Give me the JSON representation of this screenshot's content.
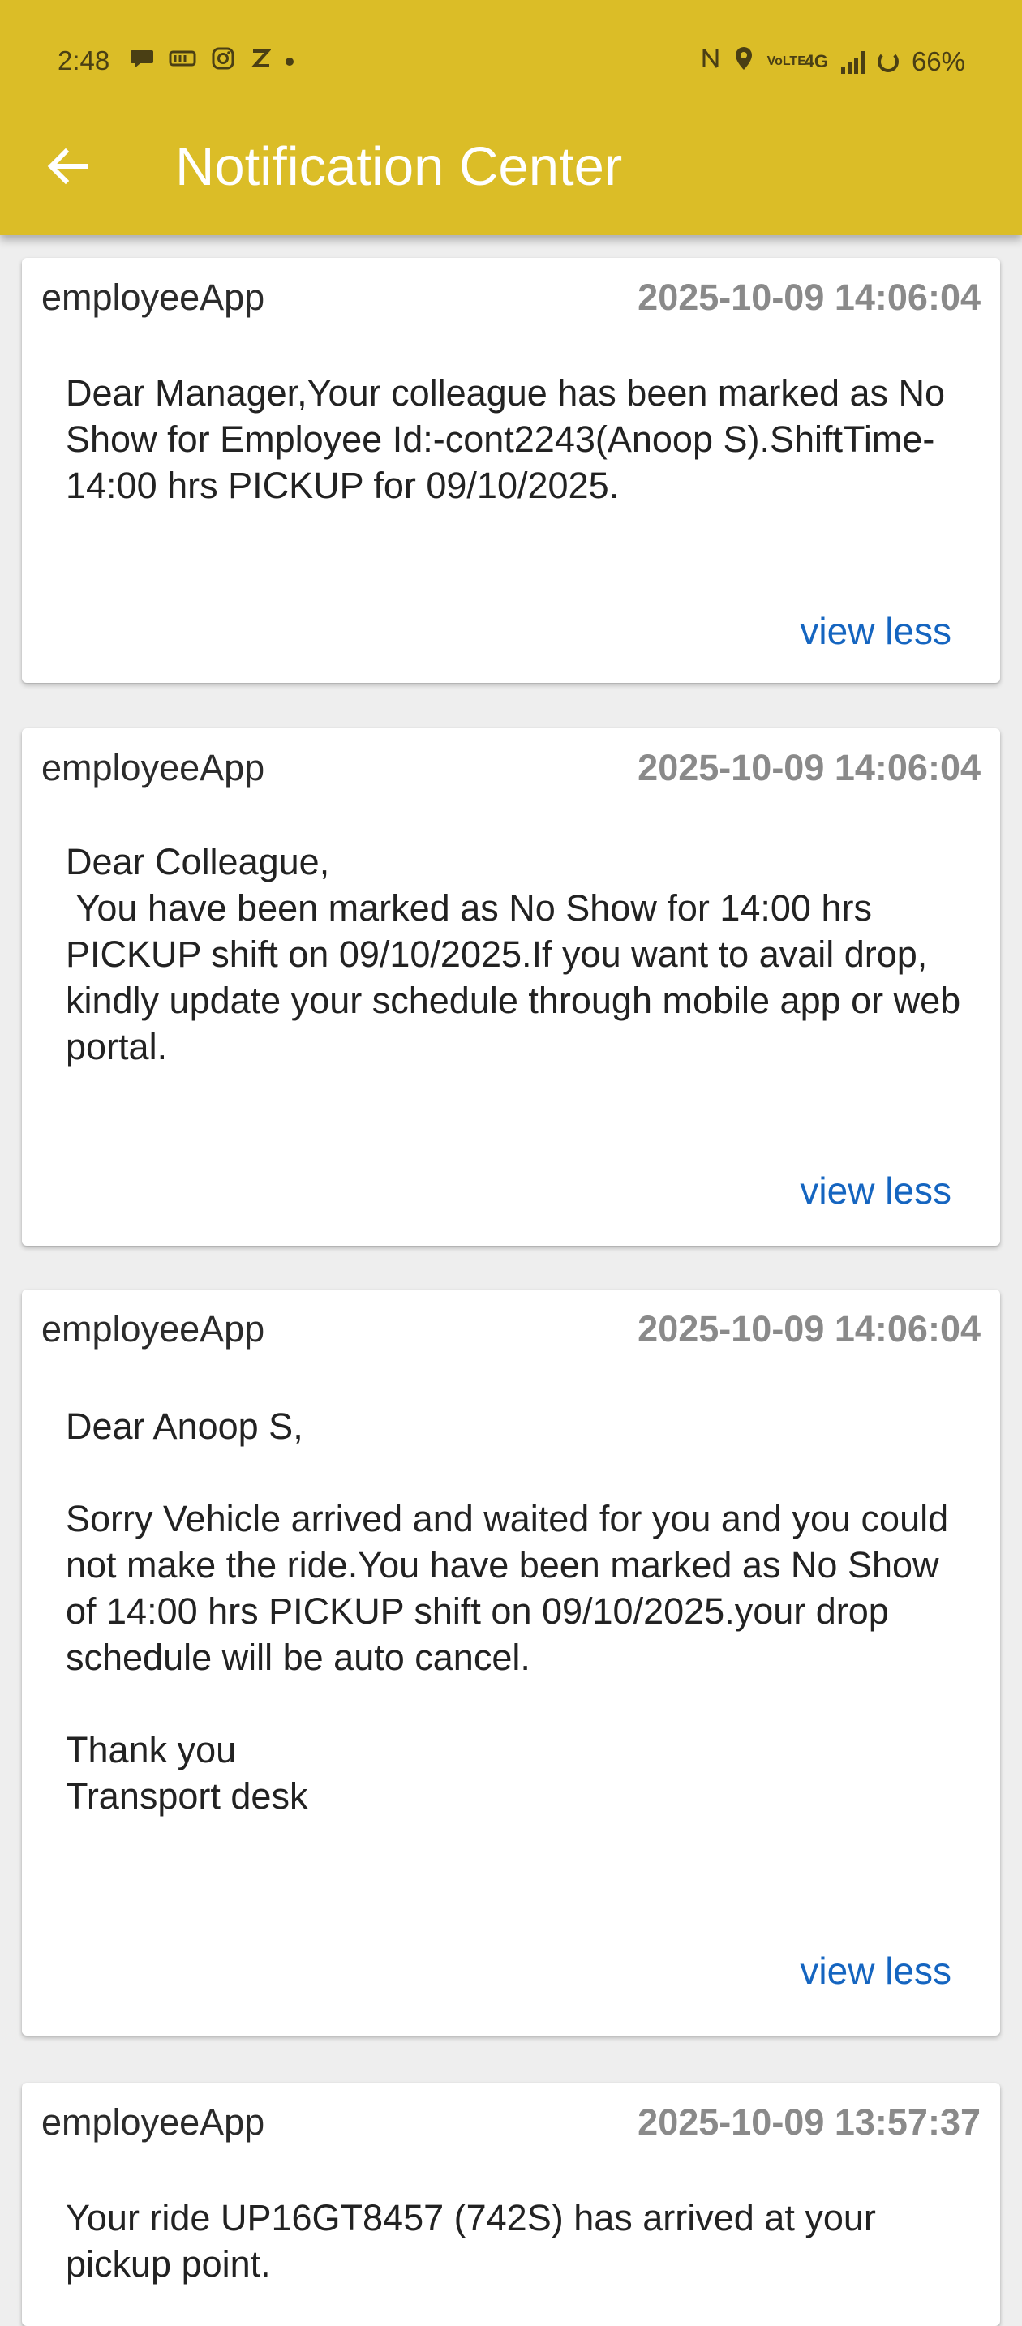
{
  "status_bar": {
    "time": "2:48",
    "left_icons": [
      "chat-bubble-icon",
      "paytm-icon",
      "instagram-icon",
      "zomato-icon",
      "dot-icon"
    ],
    "network_label": "4G",
    "volte_label": "VoLTE",
    "battery_percent": "66%"
  },
  "app_bar": {
    "title": "Notification Center",
    "back_icon": "arrow-left-icon",
    "background_color": "#dbbd27"
  },
  "notifications": [
    {
      "app": "employeeApp",
      "time": "2025-10-09 14:06:04",
      "message": "Dear Manager,Your colleague has been marked as No Show for Employee Id:-cont2243(Anoop S).ShiftTime-14:00 hrs PICKUP for 09/10/2025.",
      "toggle": "view less"
    },
    {
      "app": "employeeApp",
      "time": "2025-10-09 14:06:04",
      "message": "Dear Colleague,\n You have been marked as No Show for 14:00 hrs PICKUP shift on 09/10/2025.If you want to avail drop, kindly update your schedule through mobile app or web portal.",
      "toggle": "view less"
    },
    {
      "app": "employeeApp",
      "time": "2025-10-09 14:06:04",
      "message": "Dear Anoop S,\n\nSorry Vehicle arrived and waited for you and you could not make the ride.You have been marked as No Show of 14:00 hrs PICKUP shift on 09/10/2025.your drop schedule will be auto cancel.\n\nThank you\nTransport desk",
      "toggle": "view less"
    },
    {
      "app": "employeeApp",
      "time": "2025-10-09 13:57:37",
      "message": "Your ride UP16GT8457 (742S) has arrived at your pickup point."
    }
  ],
  "colors": {
    "link": "#1565c0",
    "timestamp": "#8a8a8a"
  }
}
